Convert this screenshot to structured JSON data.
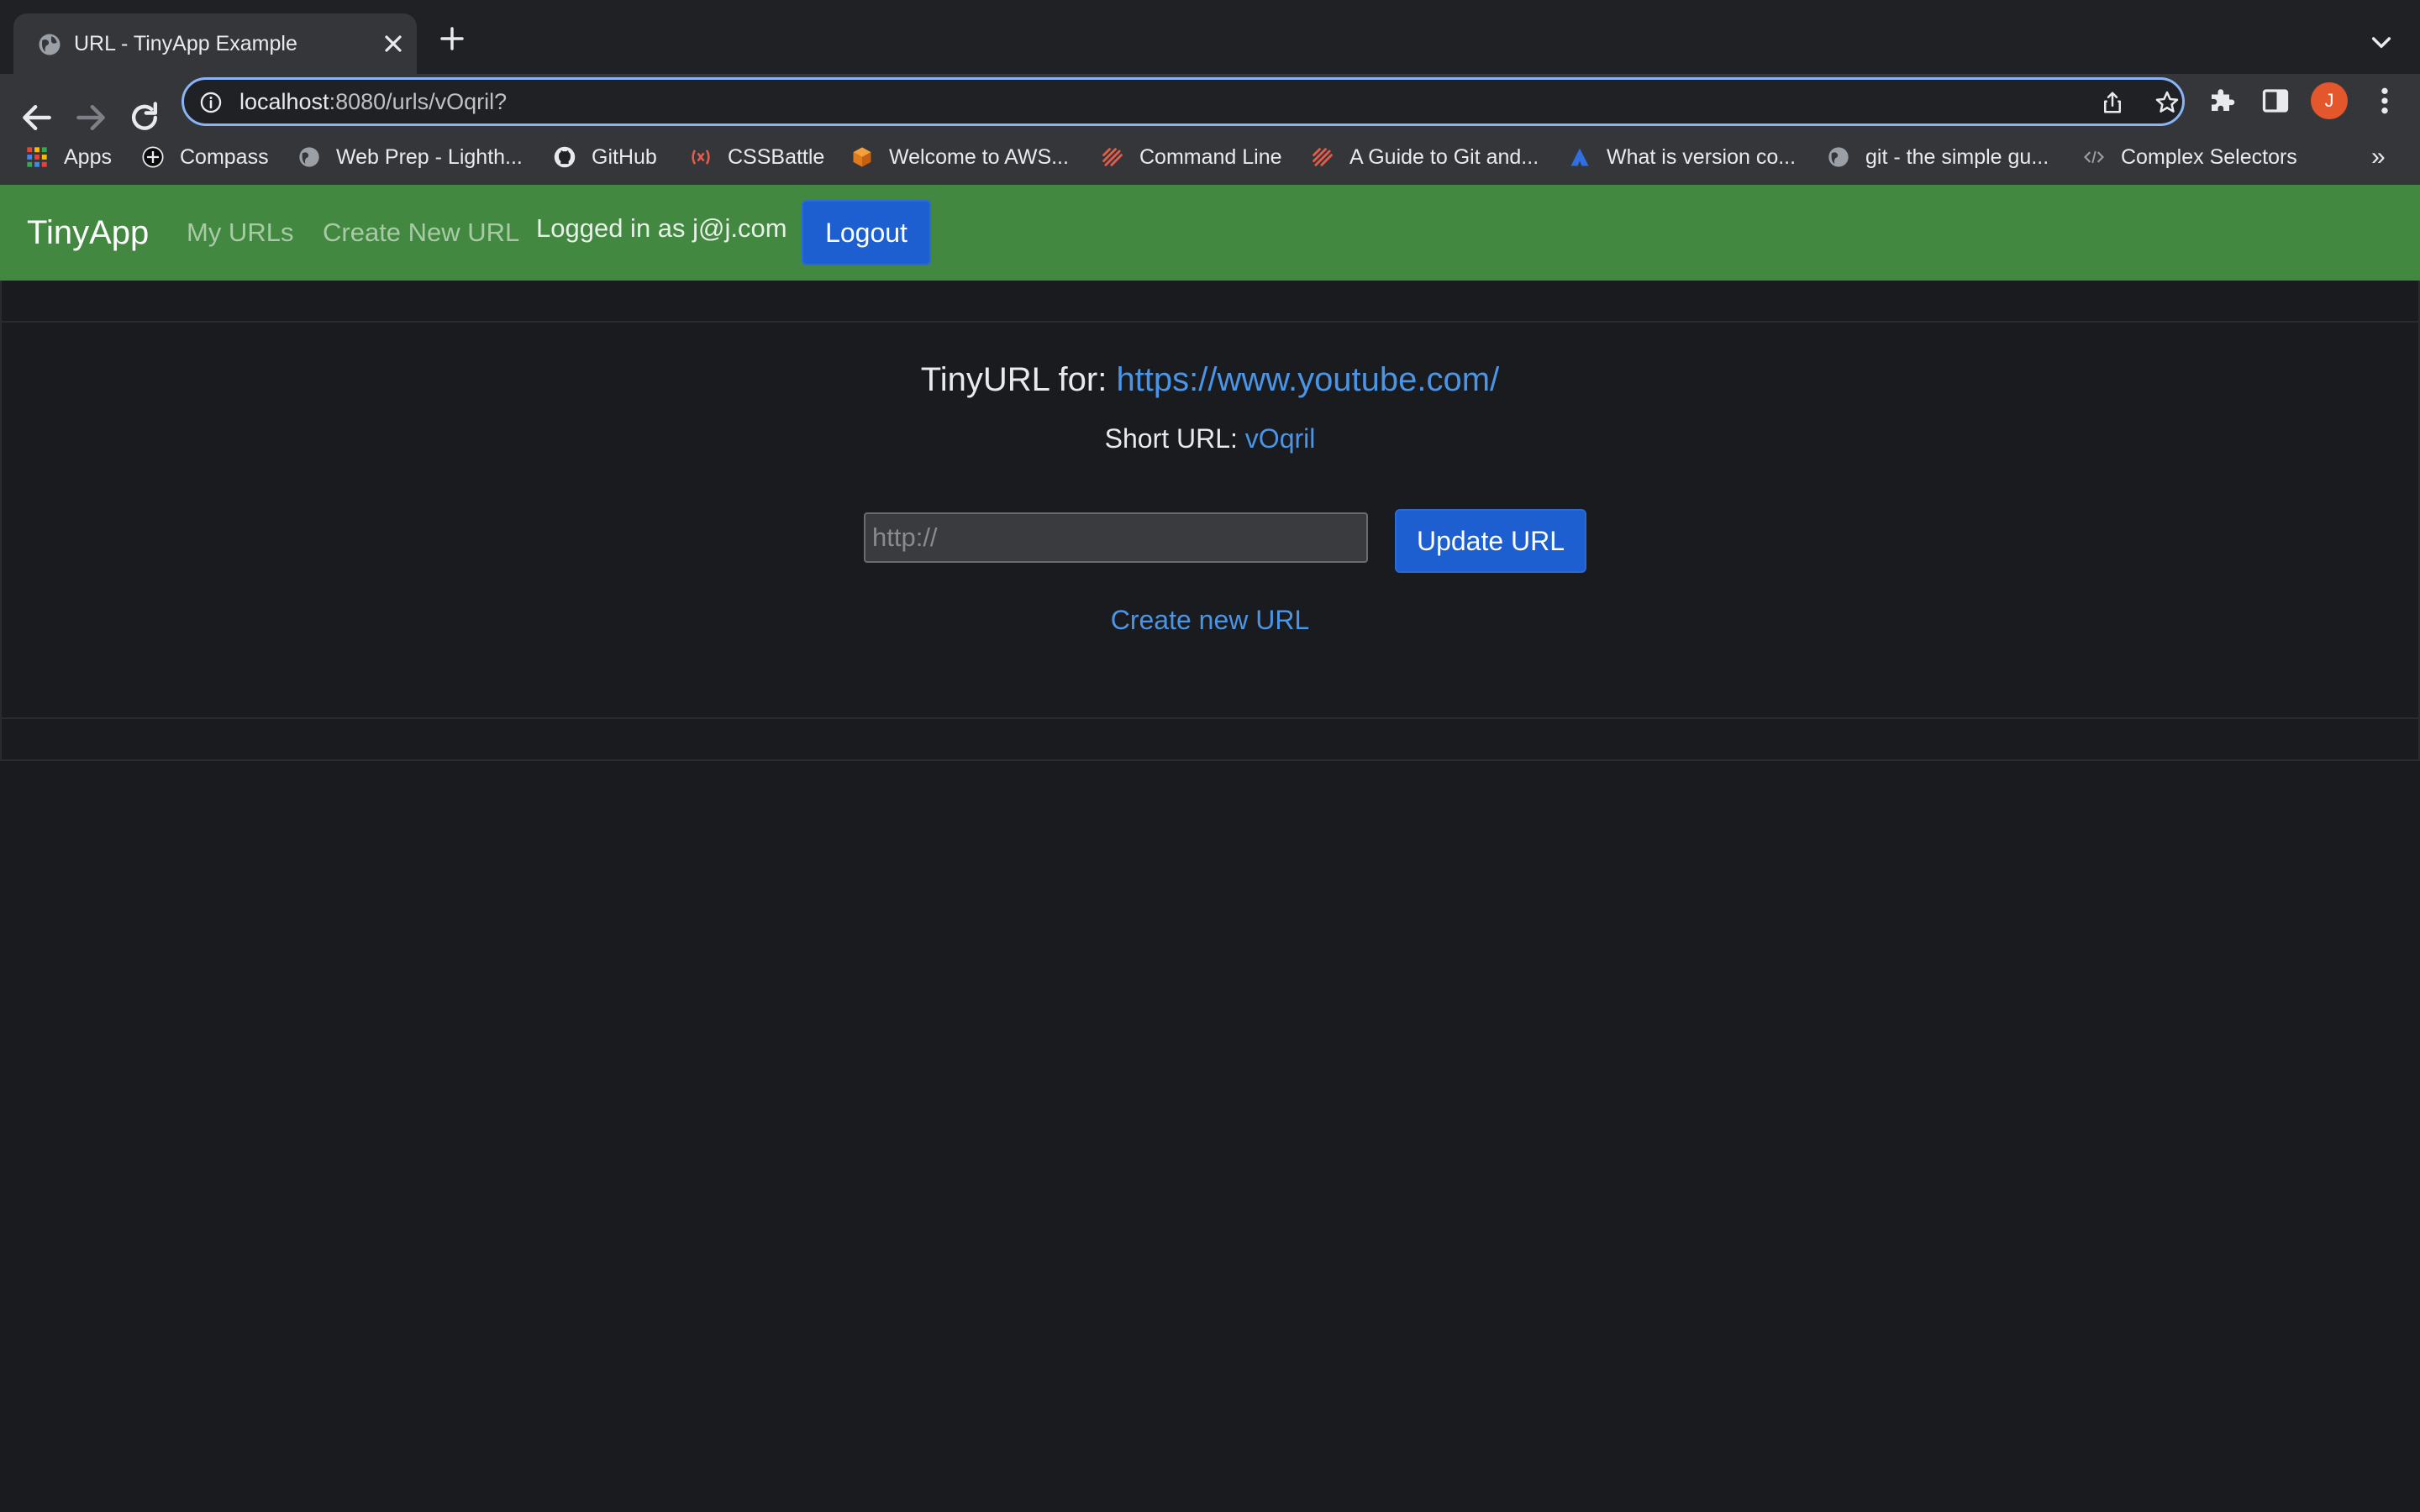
{
  "browser": {
    "tab": {
      "title": "URL - TinyApp Example"
    },
    "address_bar": {
      "host": "localhost",
      "path": ":8080/urls/vOqril?"
    },
    "profile_initial": "J",
    "bookmarks": [
      {
        "label": "Apps",
        "icon": "apps-grid-icon"
      },
      {
        "label": "Compass",
        "icon": "compass-icon"
      },
      {
        "label": "Web Prep - Lighth...",
        "icon": "globe-icon"
      },
      {
        "label": "GitHub",
        "icon": "github-icon"
      },
      {
        "label": "CSSBattle",
        "icon": "cssbattle-icon"
      },
      {
        "label": "Welcome to AWS...",
        "icon": "aws-cube-icon"
      },
      {
        "label": "Command Line",
        "icon": "stripes-icon"
      },
      {
        "label": "A Guide to Git and...",
        "icon": "stripes-icon"
      },
      {
        "label": "What is version co...",
        "icon": "atlassian-icon"
      },
      {
        "label": "git - the simple gu...",
        "icon": "globe-icon"
      },
      {
        "label": "Complex Selectors",
        "icon": "code-icon"
      }
    ],
    "bookmarks_overflow": "»"
  },
  "navbar": {
    "brand": "TinyApp",
    "links": [
      "My URLs",
      "Create New URL"
    ],
    "logged_in_text": "Logged in as j@j.com",
    "logout_label": "Logout"
  },
  "main": {
    "title_prefix": "TinyURL for: ",
    "long_url": "https://www.youtube.com/",
    "short_url_prefix": "Short URL: ",
    "short_url": "vOqril",
    "input_placeholder": "http://",
    "update_label": "Update URL",
    "create_new_link": "Create new URL"
  },
  "colors": {
    "navbar_bg": "#428840",
    "button_blue": "#1d5fd0",
    "link_blue": "#4b95e6",
    "page_bg": "#1a1b1e"
  }
}
